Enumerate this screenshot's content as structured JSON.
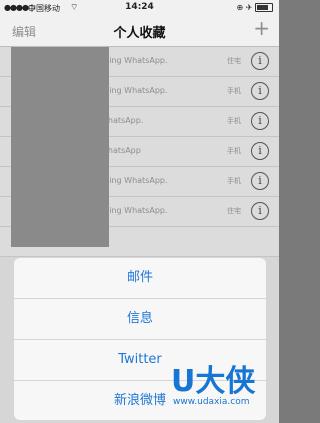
{
  "status_bar": {
    "signal": "●●●●○",
    "carrier": "中国移动",
    "wifi": "⌔",
    "time": "14:24",
    "right_icons": "⊕ ✈"
  },
  "nav": {
    "edit": "编辑",
    "title": "个人收藏",
    "add": "+"
  },
  "rows": [
    {
      "status": "using WhatsApp.",
      "type": "住宅"
    },
    {
      "status": "using WhatsApp.",
      "type": "手机"
    },
    {
      "status": "WhatsApp.",
      "type": "手机"
    },
    {
      "status": "WhatsApp",
      "type": "手机"
    },
    {
      "status": "using WhatsApp.",
      "type": "手机"
    },
    {
      "status": "using WhatsApp.",
      "type": "住宅"
    }
  ],
  "info_glyph": "i",
  "action_sheet": {
    "items": [
      "邮件",
      "信息",
      "Twitter",
      "新浪微博"
    ]
  },
  "watermark": {
    "logo": "U大侠",
    "url": "www.udaxia.com"
  },
  "colors": {
    "accent": "#1f77d6",
    "watermark": "#1775d3"
  }
}
